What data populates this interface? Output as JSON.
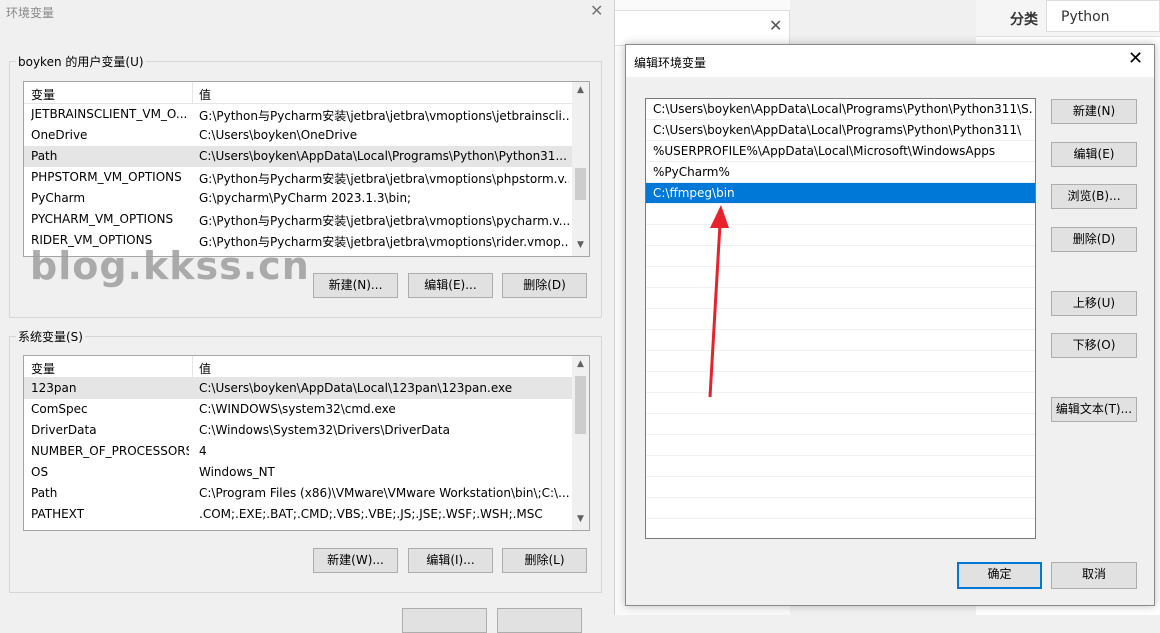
{
  "env_dialog": {
    "title": "环境变量",
    "user_group_label": "boyken 的用户变量(U)",
    "sys_group_label": "系统变量(S)",
    "col_var": "变量",
    "col_val": "值",
    "user_vars": [
      {
        "name": "JETBRAINSCLIENT_VM_O...",
        "value": "G:\\Python与Pycharm安装\\jetbra\\jetbra\\vmoptions\\jetbrainscli..."
      },
      {
        "name": "OneDrive",
        "value": "C:\\Users\\boyken\\OneDrive"
      },
      {
        "name": "Path",
        "value": "C:\\Users\\boyken\\AppData\\Local\\Programs\\Python\\Python31..."
      },
      {
        "name": "PHPSTORM_VM_OPTIONS",
        "value": "G:\\Python与Pycharm安装\\jetbra\\jetbra\\vmoptions\\phpstorm.v..."
      },
      {
        "name": "PyCharm",
        "value": "G:\\pycharm\\PyCharm 2023.1.3\\bin;"
      },
      {
        "name": "PYCHARM_VM_OPTIONS",
        "value": "G:\\Python与Pycharm安装\\jetbra\\jetbra\\vmoptions\\pycharm.v..."
      },
      {
        "name": "RIDER_VM_OPTIONS",
        "value": "G:\\Python与Pycharm安装\\jetbra\\jetbra\\vmoptions\\rider.vmop..."
      }
    ],
    "sys_vars": [
      {
        "name": "123pan",
        "value": "C:\\Users\\boyken\\AppData\\Local\\123pan\\123pan.exe"
      },
      {
        "name": "ComSpec",
        "value": "C:\\WINDOWS\\system32\\cmd.exe"
      },
      {
        "name": "DriverData",
        "value": "C:\\Windows\\System32\\Drivers\\DriverData"
      },
      {
        "name": "NUMBER_OF_PROCESSORS",
        "value": "4"
      },
      {
        "name": "OS",
        "value": "Windows_NT"
      },
      {
        "name": "Path",
        "value": "C:\\Program Files (x86)\\VMware\\VMware Workstation\\bin\\;C:\\..."
      },
      {
        "name": "PATHEXT",
        "value": ".COM;.EXE;.BAT;.CMD;.VBS;.VBE;.JS;.JSE;.WSF;.WSH;.MSC"
      }
    ],
    "user_buttons": {
      "new": "新建(N)...",
      "edit": "编辑(E)...",
      "delete": "删除(D)"
    },
    "sys_buttons": {
      "new": "新建(W)...",
      "edit": "编辑(I)...",
      "delete": "删除(L)"
    },
    "watermark": "blog.kkss.cn"
  },
  "right_panel": {
    "category_label": "分类",
    "category_value": "Python"
  },
  "edit_dialog": {
    "title": "编辑环境变量",
    "entries": [
      "C:\\Users\\boyken\\AppData\\Local\\Programs\\Python\\Python311\\S...",
      "C:\\Users\\boyken\\AppData\\Local\\Programs\\Python\\Python311\\",
      "%USERPROFILE%\\AppData\\Local\\Microsoft\\WindowsApps",
      "%PyCharm%",
      "C:\\ffmpeg\\bin"
    ],
    "buttons": {
      "new": "新建(N)",
      "edit": "编辑(E)",
      "browse": "浏览(B)...",
      "delete": "删除(D)",
      "move_up": "上移(U)",
      "move_down": "下移(O)",
      "edit_text": "编辑文本(T)...",
      "ok": "确定",
      "cancel": "取消"
    }
  },
  "colors": {
    "selection": "#0078d7",
    "arrow": "#e8222a"
  }
}
